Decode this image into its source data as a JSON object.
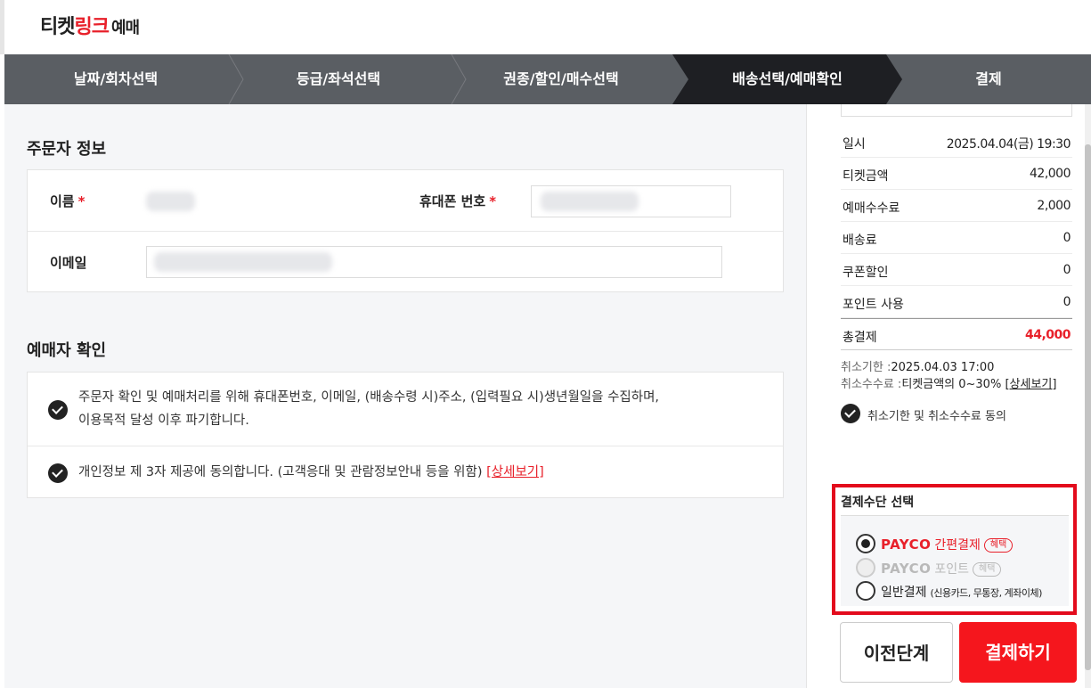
{
  "header": {
    "logo_part1": "티켓",
    "logo_part2": "링크",
    "logo_part3": "예매"
  },
  "steps": [
    {
      "label": "날짜/회차선택",
      "active": false
    },
    {
      "label": "등급/좌석선택",
      "active": false
    },
    {
      "label": "권종/할인/매수선택",
      "active": false
    },
    {
      "label": "배송선택/예매확인",
      "active": true
    },
    {
      "label": "결제",
      "active": false
    }
  ],
  "orderer": {
    "title": "주문자 정보",
    "name_label": "이름",
    "phone_label": "휴대폰 번호",
    "email_label": "이메일",
    "required_mark": "*"
  },
  "booker": {
    "title": "예매자 확인",
    "agree1_line1": "주문자 확인 및 예매처리를 위해 휴대폰번호, 이메일, (배송수령 시)주소, (입력필요 시)생년월일을 수집하며,",
    "agree1_line2": "이용목적 달성 이후 파기합니다.",
    "agree2": "개인정보 제 3자 제공에 동의합니다. (고객응대 및 관람정보안내 등을 위함)",
    "agree2_link": "[상세보기]"
  },
  "summary": {
    "rows": [
      {
        "key": "일시",
        "value": "2025.04.04(금) 19:30"
      },
      {
        "key": "티켓금액",
        "value": "42,000"
      },
      {
        "key": "예매수수료",
        "value": "2,000"
      },
      {
        "key": "배송료",
        "value": "0"
      },
      {
        "key": "쿠폰할인",
        "value": "0"
      },
      {
        "key": "포인트 사용",
        "value": "0"
      }
    ],
    "total_key": "총결제",
    "total_value": "44,000",
    "cancel_deadline_label": "취소기한 :",
    "cancel_deadline_value": "2025.04.03 17:00",
    "cancel_fee_label": "취소수수료 :",
    "cancel_fee_value": "티켓금액의 0~30%",
    "cancel_fee_link": "[상세보기]",
    "cancel_agree": "취소기한 및 취소수수료 동의"
  },
  "payment": {
    "title": "결제수단 선택",
    "options": [
      {
        "brand": "PAYCO",
        "kind": "간편결제",
        "badge": "혜택",
        "selected": true,
        "disabled": false
      },
      {
        "brand": "PAYCO",
        "kind": "포인트",
        "badge": "혜택",
        "selected": false,
        "disabled": true
      },
      {
        "brand": "",
        "kind": "일반결제",
        "detail": "(신용카드, 무통장, 계좌이체)",
        "selected": false,
        "disabled": false
      }
    ]
  },
  "buttons": {
    "prev": "이전단계",
    "pay": "결제하기"
  },
  "colors": {
    "accent": "#e8202a",
    "step_bar": "#5a5e63",
    "step_active": "#1e1f23",
    "pay_button": "#f5161d",
    "highlight_border": "#e30b1c"
  }
}
